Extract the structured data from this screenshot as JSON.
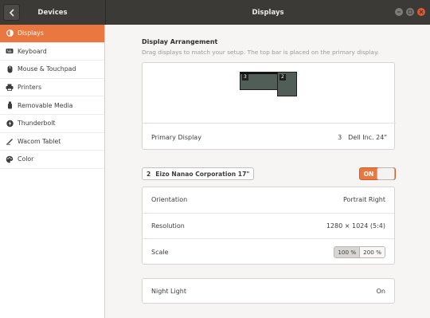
{
  "header": {
    "left_title": "Devices",
    "main_title": "Displays"
  },
  "sidebar": {
    "items": [
      {
        "label": "Displays",
        "icon": "display-icon",
        "active": true
      },
      {
        "label": "Keyboard",
        "icon": "keyboard-icon"
      },
      {
        "label": "Mouse & Touchpad",
        "icon": "mouse-icon"
      },
      {
        "label": "Printers",
        "icon": "printer-icon"
      },
      {
        "label": "Removable Media",
        "icon": "removable-media-icon"
      },
      {
        "label": "Thunderbolt",
        "icon": "thunderbolt-icon"
      },
      {
        "label": "Wacom Tablet",
        "icon": "tablet-icon"
      },
      {
        "label": "Color",
        "icon": "color-icon"
      }
    ]
  },
  "arrangement": {
    "title": "Display Arrangement",
    "subtitle": "Drag displays to match your setup. The top bar is placed on the primary display.",
    "monitors": [
      {
        "number": "3"
      },
      {
        "number": "2"
      }
    ],
    "primary_label": "Primary Display",
    "primary_number": "3",
    "primary_name": "Dell Inc. 24\""
  },
  "display": {
    "number": "2",
    "name": "Eizo Nanao Corporation 17\"",
    "switch_label": "ON"
  },
  "settings": {
    "orientation_label": "Orientation",
    "orientation_value": "Portrait Right",
    "resolution_label": "Resolution",
    "resolution_value": "1280 × 1024 (5:4)",
    "scale_label": "Scale",
    "scale_options": [
      "100 %",
      "200 %"
    ],
    "scale_selected": "100 %"
  },
  "night_light": {
    "label": "Night Light",
    "value": "On"
  },
  "colors": {
    "accent": "#e9773f",
    "header": "#3b3a36"
  }
}
